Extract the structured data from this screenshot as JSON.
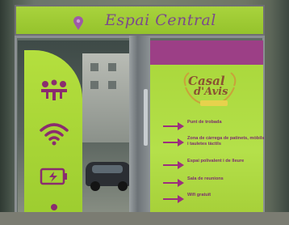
{
  "sign": {
    "title": "Espai Central",
    "icon": "location-pin-icon",
    "background": "#a9d33d",
    "text_color": "#7b4a8c"
  },
  "logo": {
    "line1": "Casal",
    "line2": "d'Avis",
    "color": "#8a5232"
  },
  "left_panel": {
    "icons": [
      "meeting-people-icon",
      "wifi-icon",
      "battery-charging-icon",
      "bath-icon"
    ],
    "color": "#b4df3e",
    "icon_color": "#8a2c6f"
  },
  "features": [
    {
      "text": "Punt de trobada"
    },
    {
      "text": "Zona de càrrega de patinets, mòbils i tauletes tàctils"
    },
    {
      "text": "Espai polivalent i de lleure"
    },
    {
      "text": "Sala de reunions"
    },
    {
      "text": "Wifi gratuït"
    }
  ],
  "colors": {
    "arrow": "#9c2f7e",
    "door_top": "#9c3f86"
  }
}
